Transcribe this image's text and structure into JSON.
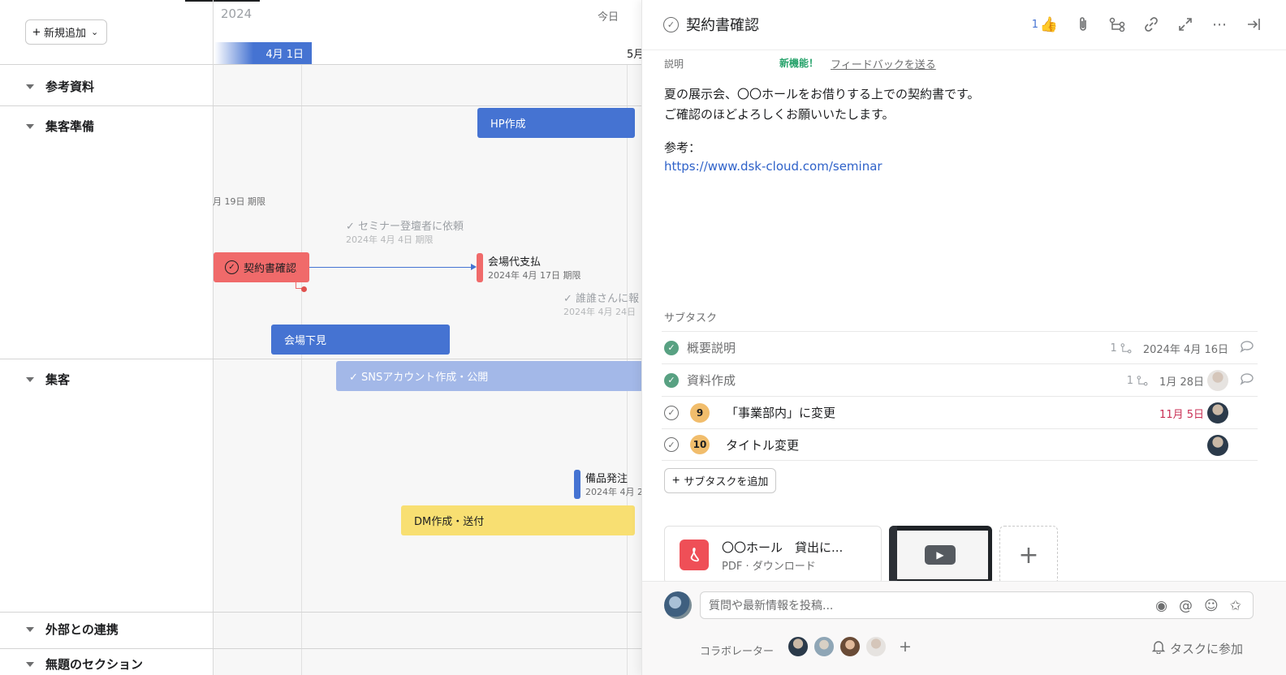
{
  "timeline": {
    "add_button": "新規追加",
    "year": "2024",
    "today": "今日",
    "month_april": "4月 1日",
    "month_april_suffix": "月",
    "month_may": "5月",
    "deadline_fragment": "月 19日 期限",
    "sections": [
      "参考資料",
      "集客準備",
      "集客",
      "外部との連携",
      "無題のセクション"
    ],
    "bars": {
      "hp": "HP作成",
      "contract": "契約書確認",
      "venue_visit": "会場下見",
      "sns": "SNSアカウント作成・公開",
      "dm": "DM作成・送付"
    },
    "milestones": {
      "venue_payment": {
        "name": "会場代支払",
        "date": "2024年 4月 17日 期限"
      },
      "equipment": {
        "name": "備品発注",
        "date": "2024年 4月 2"
      }
    },
    "done_items": {
      "seminar": {
        "name": "セミナー登壇者に依頼",
        "date": "2024年 4月 4日 期限"
      },
      "report": {
        "name": "誰誰さんに報",
        "date": "2024年 4月 24日"
      }
    }
  },
  "panel": {
    "title": "契約書確認",
    "like_count": "1",
    "description_label": "説明",
    "new_feature": "新機能！",
    "feedback": "フィードバックを送る",
    "description_lines": [
      "夏の展示会、〇〇ホールをお借りする上での契約書です。",
      "ご確認のほどよろしくお願いいたします。"
    ],
    "reference_label": "参考：",
    "reference_url": "https://www.dsk-cloud.com/seminar",
    "subtask_label": "サブタスク",
    "subtasks": [
      {
        "name": "概要説明",
        "status": "done",
        "subcount": "1",
        "date": "2024年 4月 16日"
      },
      {
        "name": "資料作成",
        "status": "done",
        "subcount": "1",
        "date": "1月 28日"
      },
      {
        "num": "9",
        "name": "「事業部内」に変更",
        "status": "open",
        "date": "11月 5日"
      },
      {
        "num": "10",
        "name": "タイトル変更",
        "status": "open",
        "date": ""
      }
    ],
    "add_subtask": "サブタスクを追加",
    "attachment": {
      "name": "〇〇ホール　貸出に...",
      "sub": "PDF · ダウンロード"
    },
    "comment_placeholder": "質問や最新情報を投稿...",
    "collaborators_label": "コラボレーター",
    "join_task": "タスクに参加"
  }
}
